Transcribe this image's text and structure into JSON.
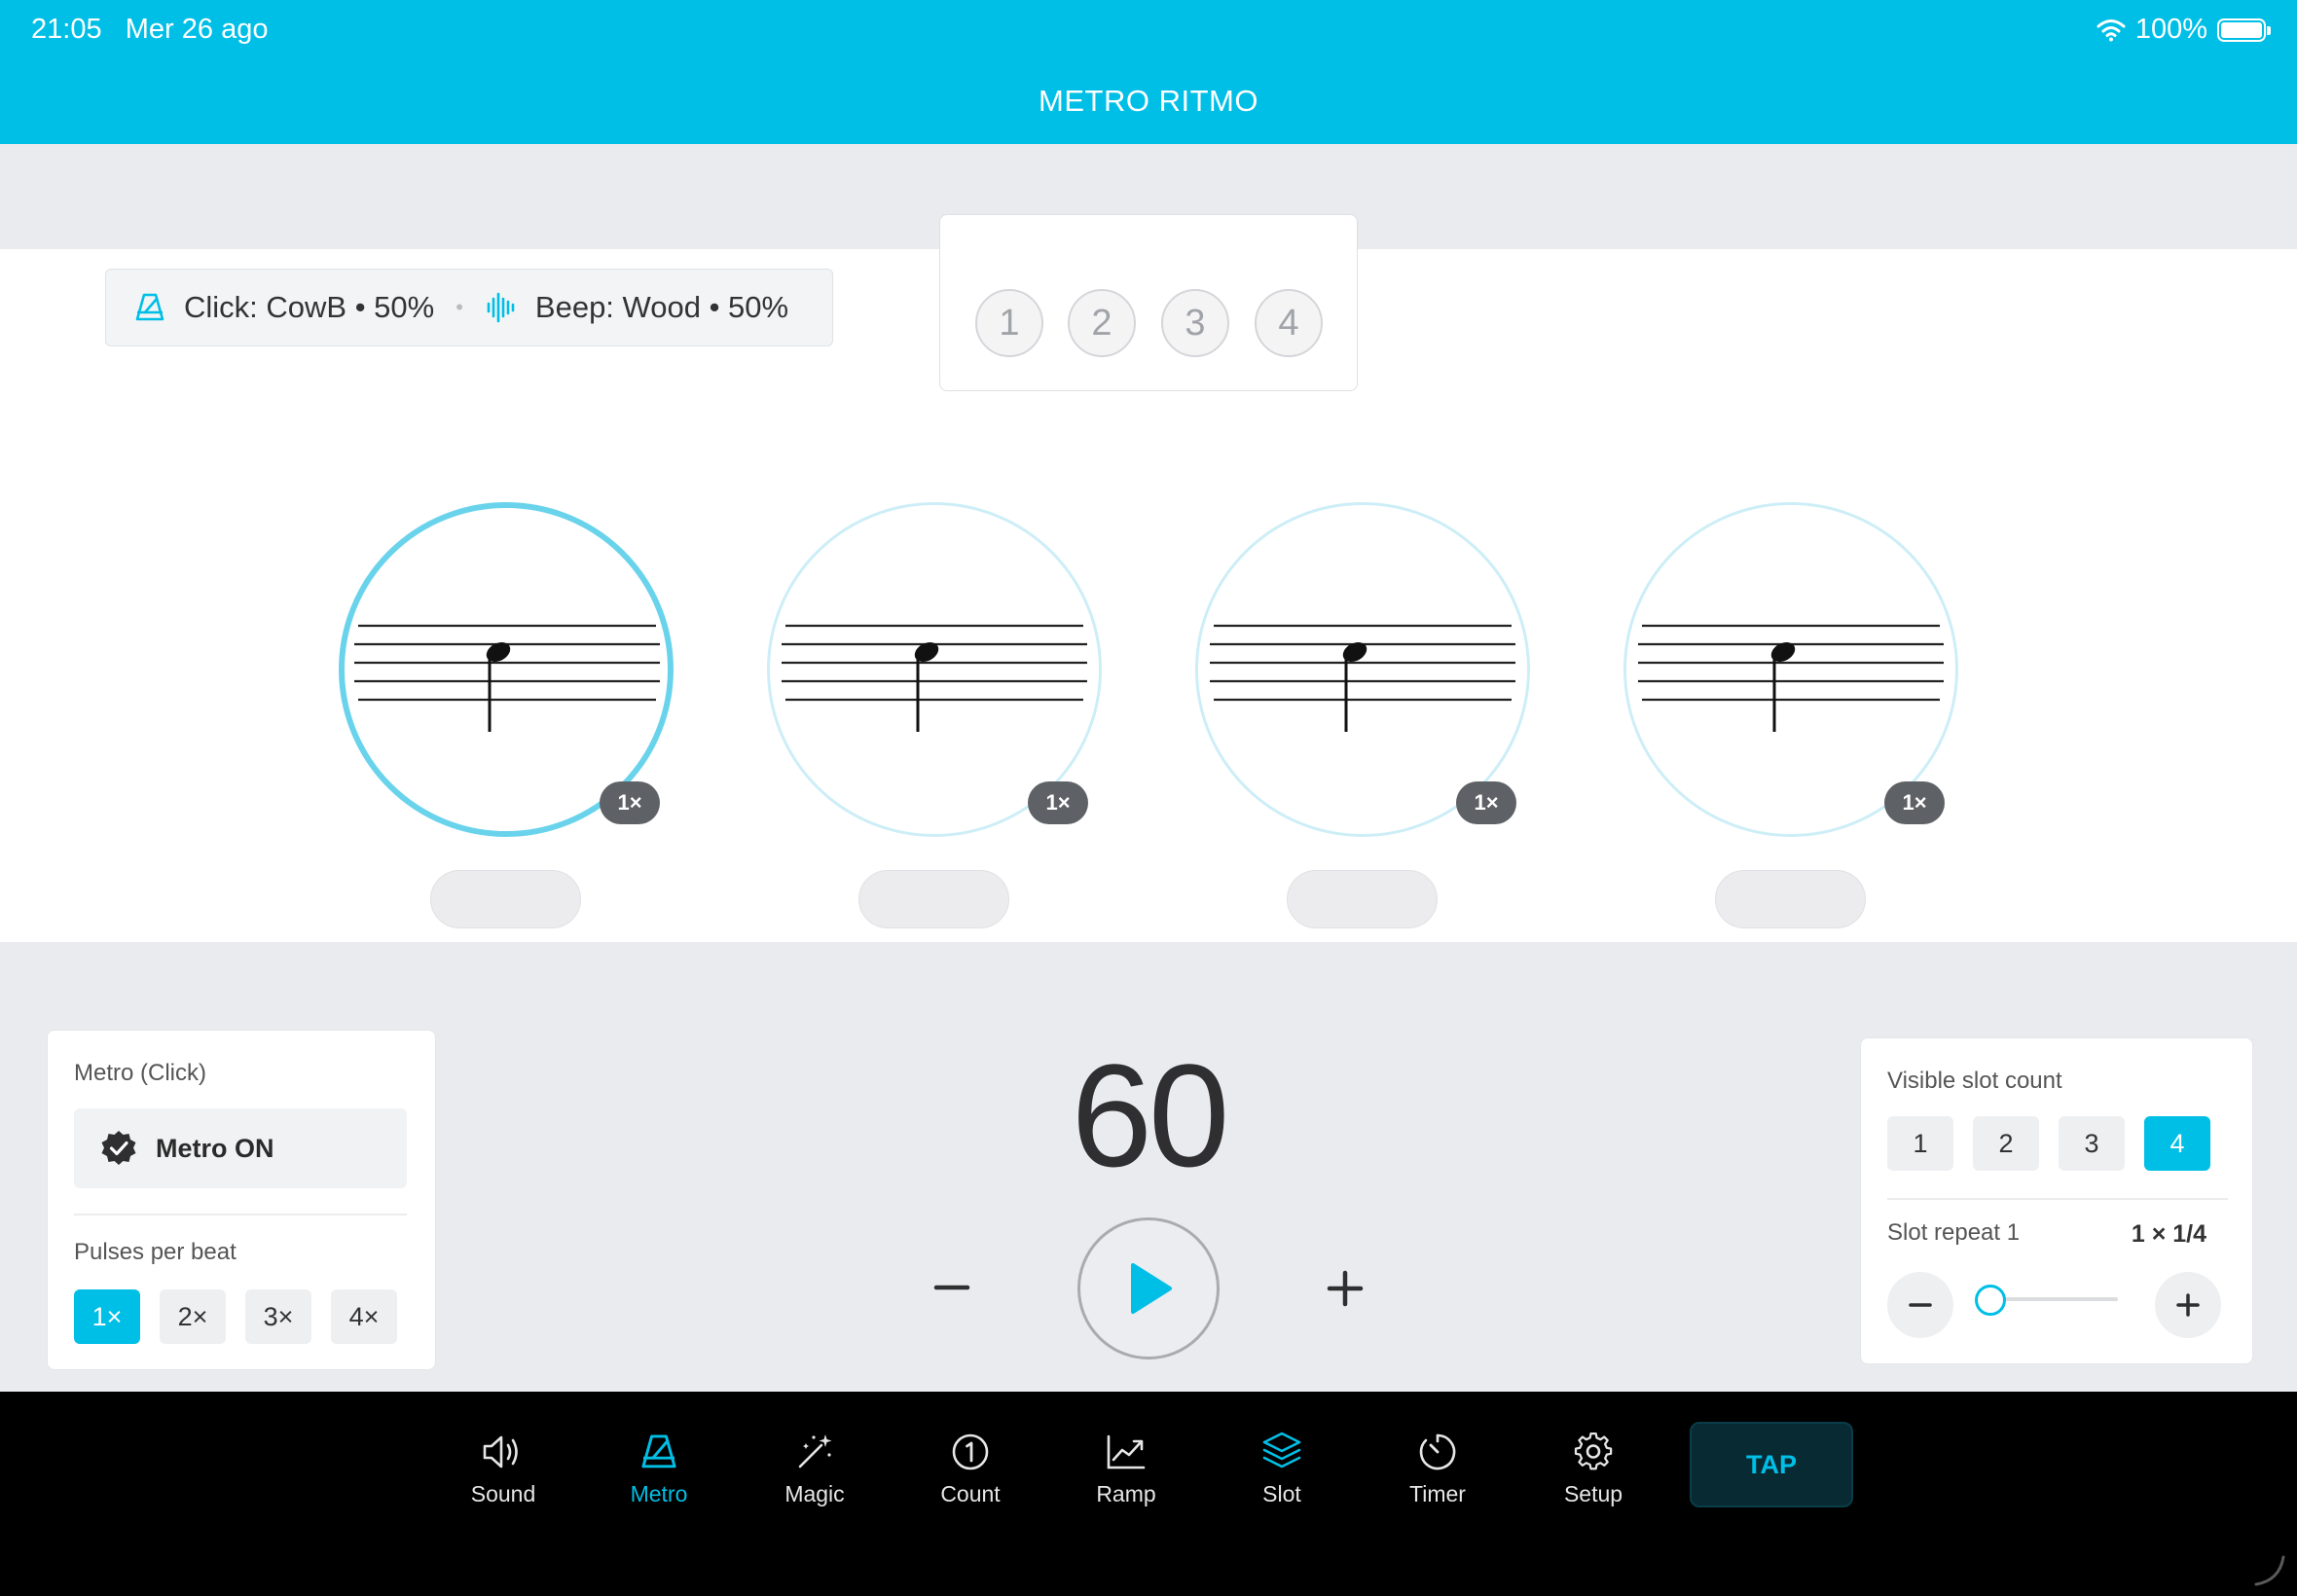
{
  "status": {
    "time": "21:05",
    "date": "Mer 26 ago",
    "battery": "100%"
  },
  "header": {
    "title": "METRO RITMO"
  },
  "sound_summary": {
    "click": "Click: CowB • 50%",
    "beep": "Beep: Wood • 50%"
  },
  "beat_indicators": [
    "1",
    "2",
    "3",
    "4"
  ],
  "slots": [
    {
      "badge": "1×",
      "active": true
    },
    {
      "badge": "1×",
      "active": false
    },
    {
      "badge": "1×",
      "active": false
    },
    {
      "badge": "1×",
      "active": false
    }
  ],
  "metro_panel": {
    "title": "Metro (Click)",
    "toggle_label": "Metro ON",
    "pulses_label": "Pulses per beat",
    "pulses": [
      "1×",
      "2×",
      "3×",
      "4×"
    ],
    "pulses_selected": 0
  },
  "tempo": {
    "bpm": "60",
    "minus": "−",
    "plus": "+"
  },
  "slot_panel": {
    "title": "Visible slot count",
    "counts": [
      "1",
      "2",
      "3",
      "4"
    ],
    "count_selected": 3,
    "repeat_label": "Slot repeat 1",
    "repeat_value": "1 × 1/4",
    "slider_fraction": 0
  },
  "tabbar": {
    "items": [
      {
        "label": "Sound",
        "icon": "speaker-icon"
      },
      {
        "label": "Metro",
        "icon": "metronome-icon"
      },
      {
        "label": "Magic",
        "icon": "magic-wand-icon"
      },
      {
        "label": "Count",
        "icon": "count-icon"
      },
      {
        "label": "Ramp",
        "icon": "ramp-chart-icon"
      },
      {
        "label": "Slot",
        "icon": "layers-icon"
      },
      {
        "label": "Timer",
        "icon": "timer-icon"
      },
      {
        "label": "Setup",
        "icon": "gear-icon"
      }
    ],
    "active_label": "Metro",
    "tap_label": "TAP"
  },
  "colors": {
    "accent": "#00bfe6",
    "tab_bar": "#000000",
    "background": "#e9ebee"
  }
}
